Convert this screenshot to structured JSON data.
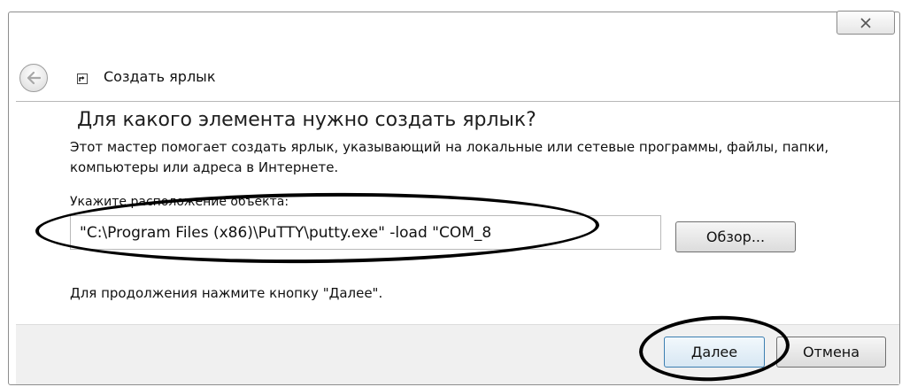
{
  "window": {
    "header_title": "Создать ярлык",
    "close_icon": "close-x-icon",
    "back_icon": "back-arrow-icon",
    "wizard_icon": "shortcut-icon"
  },
  "main": {
    "heading": "Для какого элемента нужно создать ярлык?",
    "description": "Этот мастер помогает создать ярлык, указывающий на локальные или сетевые программы, файлы, папки, компьютеры или адреса в Интернете.",
    "field_label": "Укажите расположение объекта:",
    "location_value": "\"C:\\Program Files (x86)\\PuTTY\\putty.exe\" -load \"COM_8",
    "browse_label": "Обзор...",
    "hint": "Для продолжения нажмите кнопку \"Далее\"."
  },
  "footer": {
    "next_label": "Далее",
    "cancel_label": "Отмена"
  },
  "colors": {
    "footer_bg": "#f0f0f0",
    "annotation": "#000000",
    "default_button_border": "#3c7fb1"
  }
}
